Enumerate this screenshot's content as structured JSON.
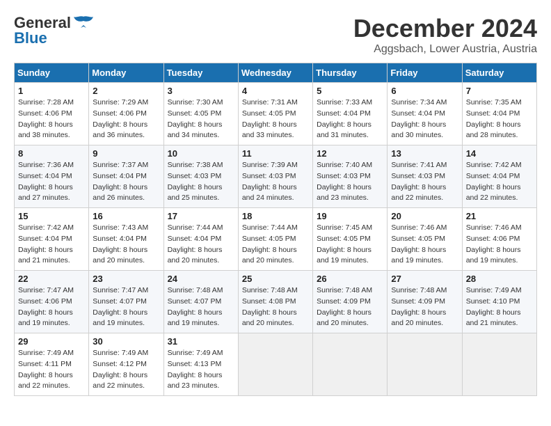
{
  "header": {
    "logo_line1": "General",
    "logo_line2": "Blue",
    "month": "December 2024",
    "location": "Aggsbach, Lower Austria, Austria"
  },
  "weekdays": [
    "Sunday",
    "Monday",
    "Tuesday",
    "Wednesday",
    "Thursday",
    "Friday",
    "Saturday"
  ],
  "weeks": [
    [
      {
        "day": "1",
        "sunrise": "7:28 AM",
        "sunset": "4:06 PM",
        "daylight": "8 hours and 38 minutes."
      },
      {
        "day": "2",
        "sunrise": "7:29 AM",
        "sunset": "4:06 PM",
        "daylight": "8 hours and 36 minutes."
      },
      {
        "day": "3",
        "sunrise": "7:30 AM",
        "sunset": "4:05 PM",
        "daylight": "8 hours and 34 minutes."
      },
      {
        "day": "4",
        "sunrise": "7:31 AM",
        "sunset": "4:05 PM",
        "daylight": "8 hours and 33 minutes."
      },
      {
        "day": "5",
        "sunrise": "7:33 AM",
        "sunset": "4:04 PM",
        "daylight": "8 hours and 31 minutes."
      },
      {
        "day": "6",
        "sunrise": "7:34 AM",
        "sunset": "4:04 PM",
        "daylight": "8 hours and 30 minutes."
      },
      {
        "day": "7",
        "sunrise": "7:35 AM",
        "sunset": "4:04 PM",
        "daylight": "8 hours and 28 minutes."
      }
    ],
    [
      {
        "day": "8",
        "sunrise": "7:36 AM",
        "sunset": "4:04 PM",
        "daylight": "8 hours and 27 minutes."
      },
      {
        "day": "9",
        "sunrise": "7:37 AM",
        "sunset": "4:04 PM",
        "daylight": "8 hours and 26 minutes."
      },
      {
        "day": "10",
        "sunrise": "7:38 AM",
        "sunset": "4:03 PM",
        "daylight": "8 hours and 25 minutes."
      },
      {
        "day": "11",
        "sunrise": "7:39 AM",
        "sunset": "4:03 PM",
        "daylight": "8 hours and 24 minutes."
      },
      {
        "day": "12",
        "sunrise": "7:40 AM",
        "sunset": "4:03 PM",
        "daylight": "8 hours and 23 minutes."
      },
      {
        "day": "13",
        "sunrise": "7:41 AM",
        "sunset": "4:03 PM",
        "daylight": "8 hours and 22 minutes."
      },
      {
        "day": "14",
        "sunrise": "7:42 AM",
        "sunset": "4:04 PM",
        "daylight": "8 hours and 22 minutes."
      }
    ],
    [
      {
        "day": "15",
        "sunrise": "7:42 AM",
        "sunset": "4:04 PM",
        "daylight": "8 hours and 21 minutes."
      },
      {
        "day": "16",
        "sunrise": "7:43 AM",
        "sunset": "4:04 PM",
        "daylight": "8 hours and 20 minutes."
      },
      {
        "day": "17",
        "sunrise": "7:44 AM",
        "sunset": "4:04 PM",
        "daylight": "8 hours and 20 minutes."
      },
      {
        "day": "18",
        "sunrise": "7:44 AM",
        "sunset": "4:05 PM",
        "daylight": "8 hours and 20 minutes."
      },
      {
        "day": "19",
        "sunrise": "7:45 AM",
        "sunset": "4:05 PM",
        "daylight": "8 hours and 19 minutes."
      },
      {
        "day": "20",
        "sunrise": "7:46 AM",
        "sunset": "4:05 PM",
        "daylight": "8 hours and 19 minutes."
      },
      {
        "day": "21",
        "sunrise": "7:46 AM",
        "sunset": "4:06 PM",
        "daylight": "8 hours and 19 minutes."
      }
    ],
    [
      {
        "day": "22",
        "sunrise": "7:47 AM",
        "sunset": "4:06 PM",
        "daylight": "8 hours and 19 minutes."
      },
      {
        "day": "23",
        "sunrise": "7:47 AM",
        "sunset": "4:07 PM",
        "daylight": "8 hours and 19 minutes."
      },
      {
        "day": "24",
        "sunrise": "7:48 AM",
        "sunset": "4:07 PM",
        "daylight": "8 hours and 19 minutes."
      },
      {
        "day": "25",
        "sunrise": "7:48 AM",
        "sunset": "4:08 PM",
        "daylight": "8 hours and 20 minutes."
      },
      {
        "day": "26",
        "sunrise": "7:48 AM",
        "sunset": "4:09 PM",
        "daylight": "8 hours and 20 minutes."
      },
      {
        "day": "27",
        "sunrise": "7:48 AM",
        "sunset": "4:09 PM",
        "daylight": "8 hours and 20 minutes."
      },
      {
        "day": "28",
        "sunrise": "7:49 AM",
        "sunset": "4:10 PM",
        "daylight": "8 hours and 21 minutes."
      }
    ],
    [
      {
        "day": "29",
        "sunrise": "7:49 AM",
        "sunset": "4:11 PM",
        "daylight": "8 hours and 22 minutes."
      },
      {
        "day": "30",
        "sunrise": "7:49 AM",
        "sunset": "4:12 PM",
        "daylight": "8 hours and 22 minutes."
      },
      {
        "day": "31",
        "sunrise": "7:49 AM",
        "sunset": "4:13 PM",
        "daylight": "8 hours and 23 minutes."
      },
      null,
      null,
      null,
      null
    ]
  ],
  "labels": {
    "sunrise": "Sunrise:",
    "sunset": "Sunset:",
    "daylight": "Daylight:"
  }
}
